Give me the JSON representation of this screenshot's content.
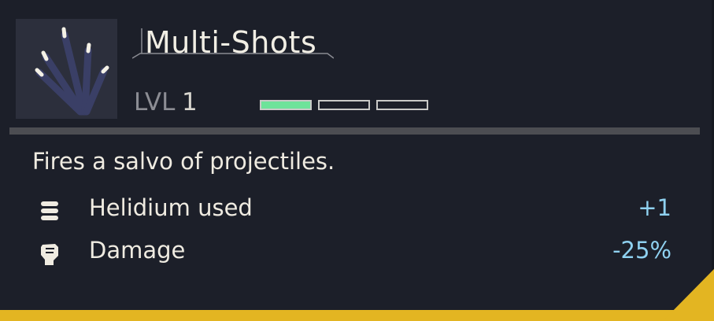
{
  "ability": {
    "title": "Multi-Shots",
    "level_label": "LVL",
    "level_value": "1",
    "level_current": 1,
    "level_max": 3,
    "description": "Fires a salvo of projectiles."
  },
  "stats": [
    {
      "icon": "stack-icon",
      "label": "Helidium used",
      "value": "+1"
    },
    {
      "icon": "fist-icon",
      "label": "Damage",
      "value": "-25%"
    }
  ],
  "colors": {
    "level_fill": "#6ee39a",
    "value_text": "#8fd1f0",
    "accent": "#e3b522",
    "background": "#1c1f29"
  }
}
